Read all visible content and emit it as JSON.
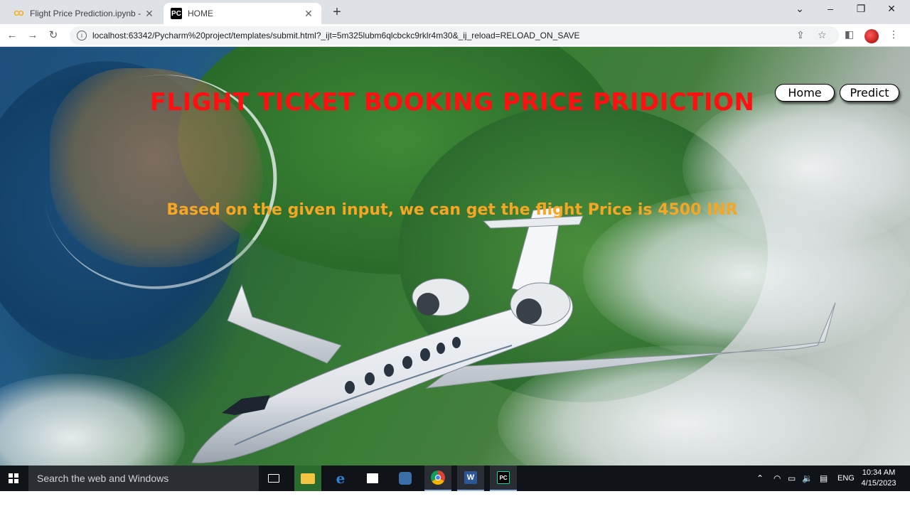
{
  "browser": {
    "tabs": [
      {
        "title": "Flight Price Prediction.ipynb - Co",
        "favicon": "colab-icon",
        "active": false
      },
      {
        "title": "HOME",
        "favicon": "pycharm-icon",
        "active": true
      }
    ],
    "url": "localhost:63342/Pycharm%20project/templates/submit.html?_ijt=5m325lubm6qlcbckc9rklr4m30&_ij_reload=RELOAD_ON_SAVE"
  },
  "page": {
    "heading": "FLIGHT TICKET BOOKING PRICE PRIDICTION",
    "result_text": "Based on the given input, we can get the flight Price is 4500 INR",
    "nav": {
      "home": "Home",
      "predict": "Predict"
    },
    "colors": {
      "heading": "#ff1010",
      "result": "#f5a623"
    }
  },
  "taskbar": {
    "search_placeholder": "Search the web and Windows",
    "language": "ENG",
    "time": "10:34 AM",
    "date": "4/15/2023"
  }
}
